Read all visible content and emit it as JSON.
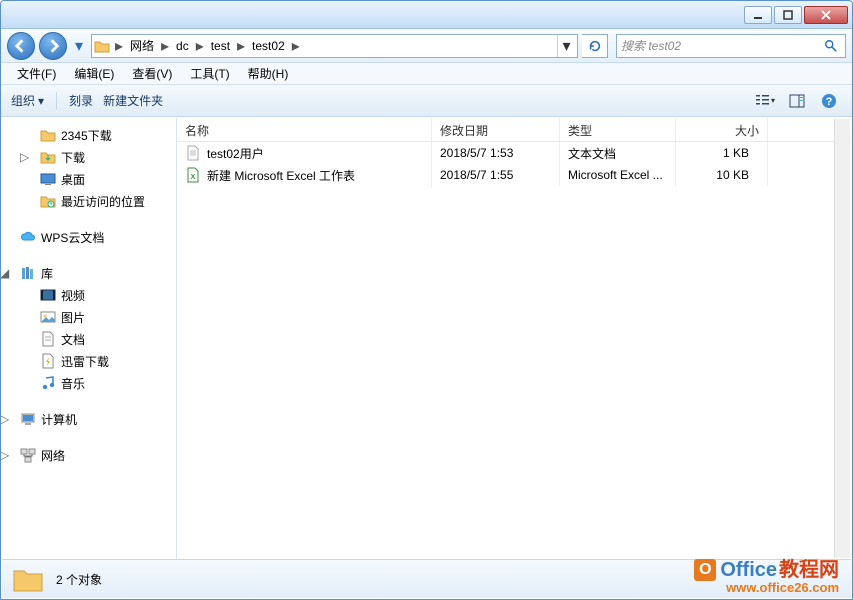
{
  "titlebar": {},
  "nav": {
    "crumbs": [
      "网络",
      "dc",
      "test",
      "test02"
    ]
  },
  "search": {
    "placeholder": "搜索 test02"
  },
  "menubar": {
    "file": "文件(F)",
    "edit": "编辑(E)",
    "view": "查看(V)",
    "tools": "工具(T)",
    "help": "帮助(H)"
  },
  "toolbar": {
    "organize": "组织",
    "burn": "刻录",
    "newfolder": "新建文件夹"
  },
  "tree": {
    "items": [
      {
        "label": "2345下载",
        "icon": "folder",
        "level": 2
      },
      {
        "label": "下载",
        "icon": "download",
        "level": 2,
        "exp": "▷"
      },
      {
        "label": "桌面",
        "icon": "desktop",
        "level": 2
      },
      {
        "label": "最近访问的位置",
        "icon": "recent",
        "level": 2
      },
      {
        "gap": true
      },
      {
        "label": "WPS云文档",
        "icon": "cloud",
        "level": 1
      },
      {
        "gap": true
      },
      {
        "label": "库",
        "icon": "library",
        "level": 1,
        "exp": "◢"
      },
      {
        "label": "视频",
        "icon": "video",
        "level": 2
      },
      {
        "label": "图片",
        "icon": "picture",
        "level": 2
      },
      {
        "label": "文档",
        "icon": "document",
        "level": 2
      },
      {
        "label": "迅雷下载",
        "icon": "thunder",
        "level": 2
      },
      {
        "label": "音乐",
        "icon": "music",
        "level": 2
      },
      {
        "gap": true
      },
      {
        "label": "计算机",
        "icon": "computer",
        "level": 1,
        "exp": "▷"
      },
      {
        "gap": true
      },
      {
        "label": "网络",
        "icon": "network",
        "level": 1,
        "exp": "▷"
      }
    ]
  },
  "columns": {
    "name": "名称",
    "date": "修改日期",
    "type": "类型",
    "size": "大小"
  },
  "files": [
    {
      "name": "test02用户",
      "date": "2018/5/7 1:53",
      "type": "文本文档",
      "size": "1 KB",
      "icon": "txt"
    },
    {
      "name": "新建 Microsoft Excel 工作表",
      "date": "2018/5/7 1:55",
      "type": "Microsoft Excel ...",
      "size": "10 KB",
      "icon": "xls"
    }
  ],
  "statusbar": {
    "count": "2 个对象"
  },
  "watermark": {
    "line1_a": "Office",
    "line1_b": "教程网",
    "line2": "www.office26.com"
  }
}
